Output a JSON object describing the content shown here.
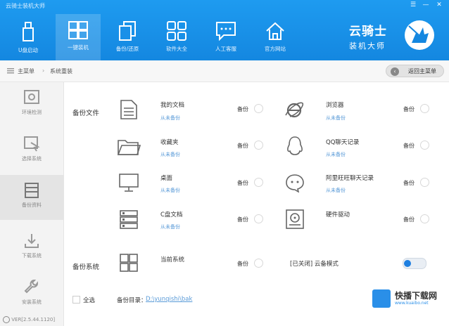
{
  "app": {
    "title": "云骑士装机大师",
    "window_controls": [
      "☰",
      "—",
      "✕"
    ]
  },
  "toolbar": {
    "items": [
      {
        "label": "U盘启动",
        "icon": "usb-drive-icon"
      },
      {
        "label": "一键装机",
        "icon": "windows-install-icon"
      },
      {
        "label": "备份/还原",
        "icon": "backup-restore-icon"
      },
      {
        "label": "软件大全",
        "icon": "software-grid-icon"
      },
      {
        "label": "人工客服",
        "icon": "chat-support-icon"
      },
      {
        "label": "官方网站",
        "icon": "home-icon"
      }
    ]
  },
  "logo": {
    "line1": "云骑士",
    "line2": "装机大师"
  },
  "breadcrumb": {
    "home": "主菜单",
    "current": "系统重装"
  },
  "back_button": {
    "label": "返回主菜单",
    "icon": "back-arrow-icon"
  },
  "sidebar": {
    "items": [
      {
        "label": "环境检测",
        "icon": "environment-check-icon"
      },
      {
        "label": "选择系统",
        "icon": "select-system-icon"
      },
      {
        "label": "备份资料",
        "icon": "backup-data-icon"
      },
      {
        "label": "下载系统",
        "icon": "download-icon"
      },
      {
        "label": "安装系统",
        "icon": "wrench-icon"
      }
    ]
  },
  "backup_files": {
    "section_label": "备份文件",
    "backup_word": "备份",
    "items": [
      {
        "name": "我的文档",
        "status": "从未备份"
      },
      {
        "name": "浏览器",
        "status": "从未备份"
      },
      {
        "name": "收藏夹",
        "status": "从未备份"
      },
      {
        "name": "QQ聊天记录",
        "status": "从未备份"
      },
      {
        "name": "桌面",
        "status": "从未备份"
      },
      {
        "name": "阿里旺旺聊天记录",
        "status": "从未备份"
      },
      {
        "name": "C盘文档",
        "status": "从未备份"
      },
      {
        "name": "硬件驱动",
        "status": ""
      }
    ]
  },
  "backup_system": {
    "section_label": "备份系统",
    "name": "当前系统",
    "backup_word": "备份",
    "mode_text": "[已关闭] 云备模式"
  },
  "bottom": {
    "select_all": "全选",
    "dir_label": "备份目录：",
    "dir_path": "D:\\yunqishi\\bak"
  },
  "version": {
    "text": "VER[2.5.44.1120]"
  },
  "watermark": {
    "title": "快播下载网",
    "url": "www.kuaibo.net"
  },
  "colors": {
    "header": "#1e9bf0",
    "accent": "#1e7fe0",
    "status": "#5a9bd8"
  }
}
